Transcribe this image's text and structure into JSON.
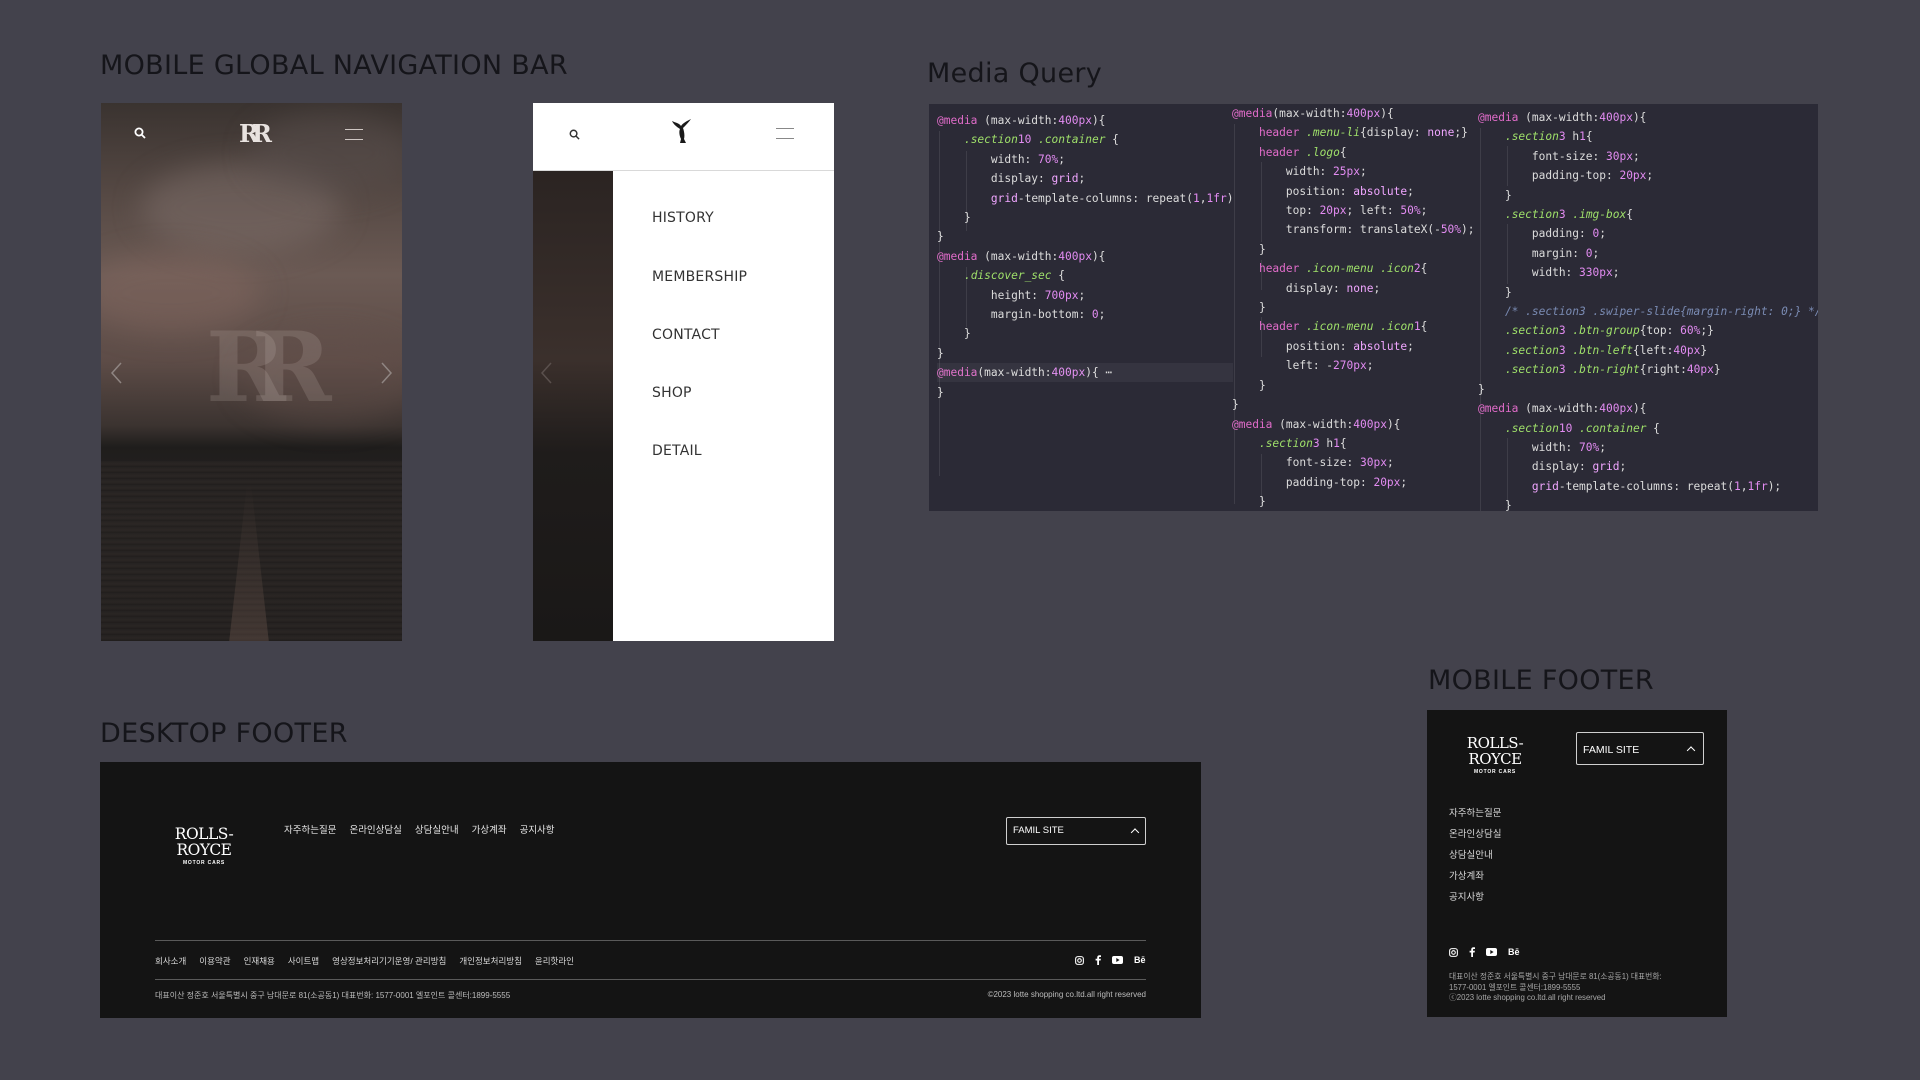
{
  "sections": {
    "mobile_nav": "MOBILE GLOBAL NAVIGATION BAR",
    "media_query": "Media Query",
    "desktop_footer": "DESKTOP FOOTER",
    "mobile_footer": "MOBILE FOOTER"
  },
  "mobile_nav": {
    "logo_text": "RR",
    "menu_items": [
      "HISTORY",
      "MEMBERSHIP",
      "CONTACT",
      "SHOP",
      "DETAIL"
    ]
  },
  "code": {
    "col1": [
      "@media (max-width:400px){",
      "    .section10 .container {",
      "        width: 70%;",
      "        display: grid;",
      "        grid-template-columns: repeat(1,1fr);",
      "    }",
      "}",
      "@media (max-width:400px){",
      "    .discover_sec {",
      "        height: 700px;",
      "        margin-bottom: 0;",
      "    }",
      "}",
      "@media(max-width:400px){ ⋯",
      "}"
    ],
    "col2": [
      "@media(max-width:400px){",
      "    header .menu-li{display: none;}",
      "    header .logo{",
      "        width: 25px;",
      "        position: absolute;",
      "        top: 20px; left: 50%;",
      "        transform: translateX(-50%);",
      "    }",
      "    header .icon-menu .icon2{",
      "        display: none;",
      "    }",
      "    header .icon-menu .icon1{",
      "        position: absolute;",
      "        left: -270px;",
      "    }",
      "}",
      "@media (max-width:400px){",
      "    .section3 h1{",
      "        font-size: 30px;",
      "        padding-top: 20px;",
      "    }"
    ],
    "col3": [
      "@media (max-width:400px){",
      "    .section3 h1{",
      "        font-size: 30px;",
      "        padding-top: 20px;",
      "    }",
      "    .section3 .img-box{",
      "        padding: 0;",
      "        margin: 0;",
      "        width: 330px;",
      "    }",
      "    /* .section3 .swiper-slide{margin-right: 0;} */",
      "    .section3 .btn-group{top: 60%;}",
      "    .section3 .btn-left{left:40px}",
      "    .section3 .btn-right{right:40px}",
      "}",
      "@media (max-width:400px){",
      "    .section10 .container {",
      "        width: 70%;",
      "        display: grid;",
      "        grid-template-columns: repeat(1,1fr);",
      "    }"
    ]
  },
  "desktop_footer": {
    "brand_line1": "ROLLS-ROYCE",
    "brand_line2": "MOTOR CARS",
    "links": [
      "자주하는질문",
      "온라인상담실",
      "상담실안내",
      "가상계좌",
      "공지사항"
    ],
    "family_site": "FAMIL SITE",
    "bottom_links": [
      "회사소개",
      "이용약관",
      "인재채용",
      "사이트맵",
      "영상정보처리기기운영/ 관리방침",
      "개인정보처리방침",
      "윤리핫라인"
    ],
    "address": "대표이산 정준호 서울특별시 중구 남대문로 81(소공동1) 대표번화: 1577-0001 엘포인트 콜센터:1899-5555",
    "copyright": "©2023 lotte shopping co.ltd.all right reserved",
    "behance": "Bē"
  },
  "mobile_footer": {
    "brand_line1": "ROLLS-ROYCE",
    "brand_line2": "MOTOR CARS",
    "family_site": "FAMIL SITE",
    "links": [
      "자주하는질문",
      "온라인상담실",
      "상담실안내",
      "가상계좌",
      "공지사항"
    ],
    "address_line1": "대표이산 정준호 서울특별시 중구 남대문로 81(소공동1) 대표번화:",
    "address_line2": "1577-0001 엘포인트 콜센터:1899-5555",
    "copyright": "ⓒ2023 lotte shopping co.ltd.all right reserved",
    "behance": "Bē"
  },
  "colors": {
    "canvas": "#43424c",
    "footer_bg": "#141414",
    "code_bg": "#2b2a36"
  }
}
